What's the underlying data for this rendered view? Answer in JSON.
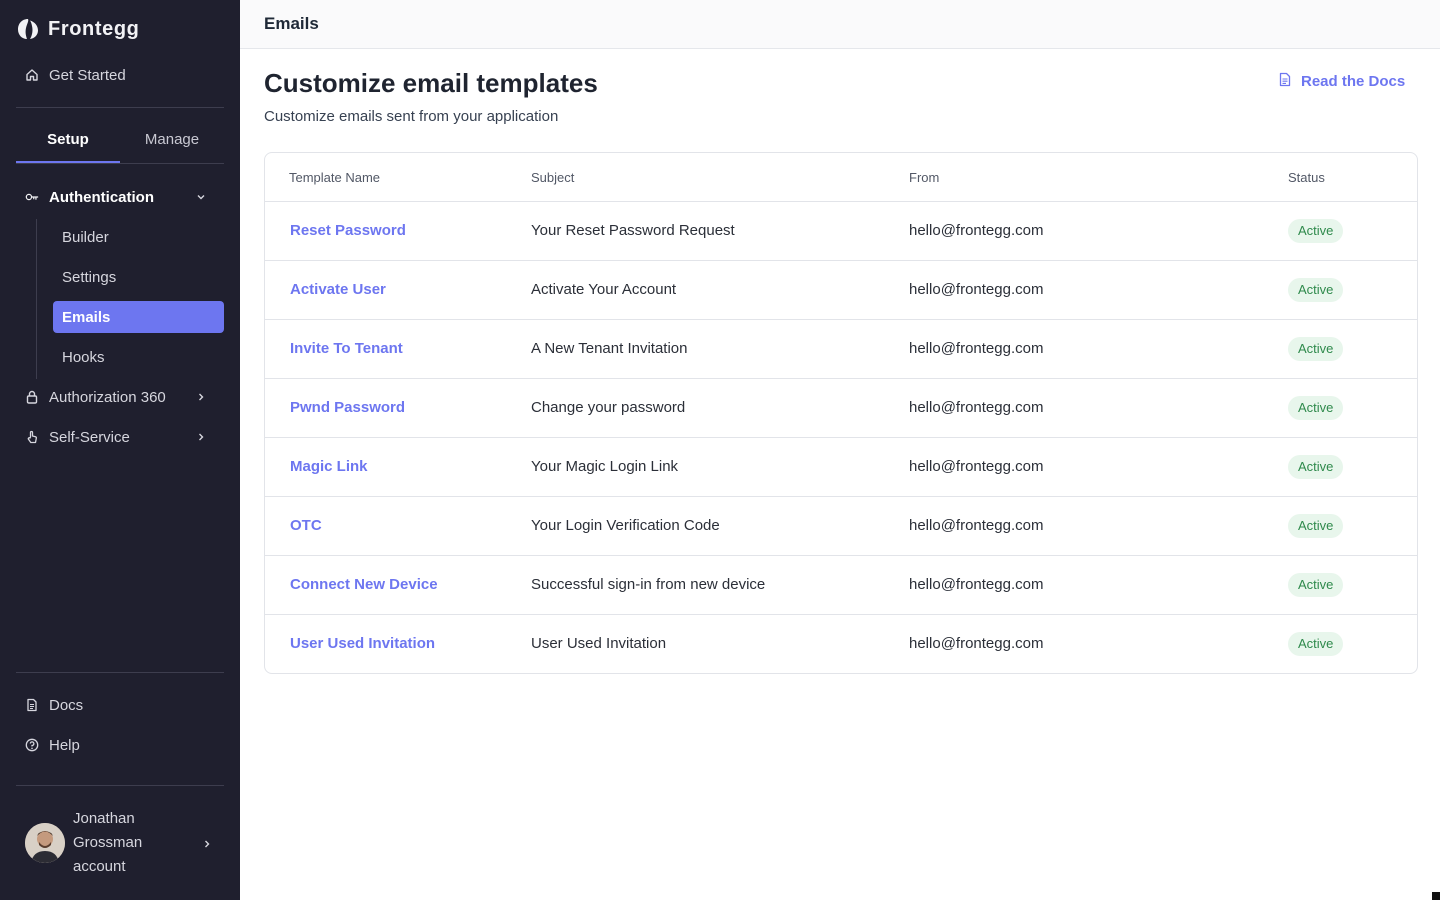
{
  "sidebar": {
    "logo_text": "Frontegg",
    "get_started": "Get Started",
    "tabs": [
      {
        "label": "Setup",
        "active": true
      },
      {
        "label": "Manage",
        "active": false
      }
    ],
    "authentication": "Authentication",
    "auth_items": [
      {
        "label": "Builder"
      },
      {
        "label": "Settings"
      },
      {
        "label": "Emails",
        "active": true
      },
      {
        "label": "Hooks"
      }
    ],
    "authorization": "Authorization 360",
    "self_service": "Self-Service",
    "docs": "Docs",
    "help": "Help",
    "user_name": "Jonathan Grossman account"
  },
  "topbar": {
    "title": "Emails"
  },
  "page": {
    "title": "Customize email templates",
    "subtitle": "Customize emails sent from your application",
    "docs_link": "Read the Docs"
  },
  "table": {
    "columns": [
      "Template Name",
      "Subject",
      "From",
      "Status"
    ],
    "rows": [
      {
        "name": "Reset Password",
        "subject": "Your Reset Password Request",
        "from": "hello@frontegg.com",
        "status": "Active"
      },
      {
        "name": "Activate User",
        "subject": "Activate Your Account",
        "from": "hello@frontegg.com",
        "status": "Active"
      },
      {
        "name": "Invite To Tenant",
        "subject": "A New Tenant Invitation",
        "from": "hello@frontegg.com",
        "status": "Active"
      },
      {
        "name": "Pwnd Password",
        "subject": "Change your password",
        "from": "hello@frontegg.com",
        "status": "Active"
      },
      {
        "name": "Magic Link",
        "subject": "Your Magic Login Link",
        "from": "hello@frontegg.com",
        "status": "Active"
      },
      {
        "name": "OTC",
        "subject": "Your Login Verification Code",
        "from": "hello@frontegg.com",
        "status": "Active"
      },
      {
        "name": "Connect New Device",
        "subject": "Successful sign-in from new device",
        "from": "hello@frontegg.com",
        "status": "Active"
      },
      {
        "name": "User Used Invitation",
        "subject": "User Used Invitation",
        "from": "hello@frontegg.com",
        "status": "Active"
      }
    ]
  },
  "colors": {
    "sidebar_bg": "#1f1f2e",
    "accent": "#6d76f0",
    "badge_bg": "#e8f6ec",
    "badge_text": "#2f8a4c"
  }
}
